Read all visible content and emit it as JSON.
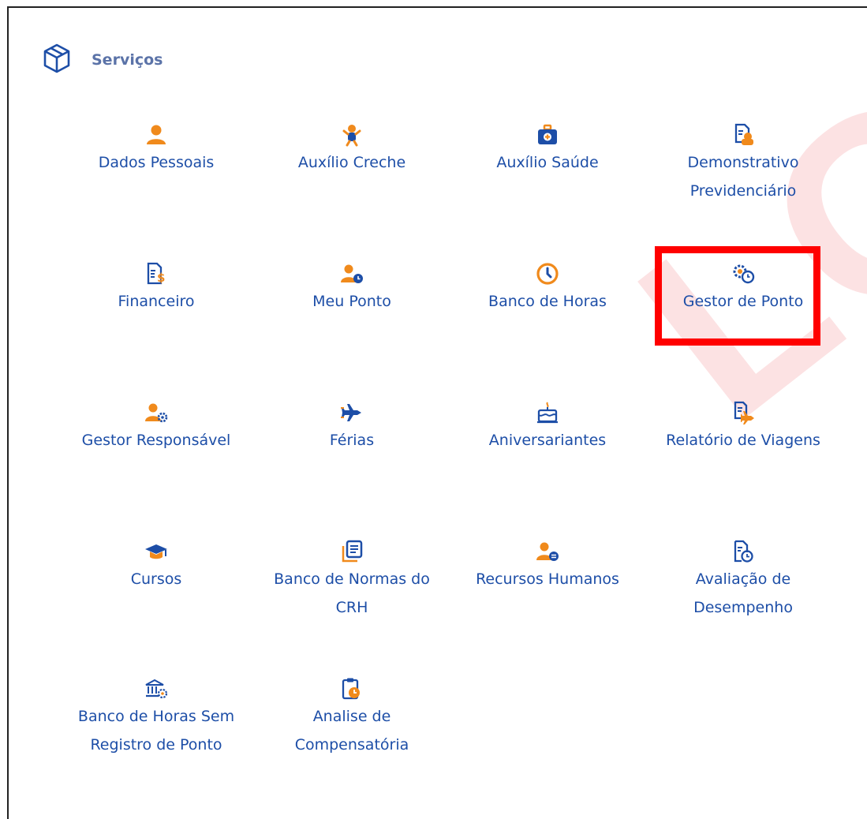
{
  "header": {
    "title": "Serviços",
    "icon": "package-icon"
  },
  "watermark": "LOG",
  "colors": {
    "accent_orange": "#f08a1c",
    "text_blue": "#1d4ea7",
    "icon_blue": "#1d4ea7",
    "header_gray_blue": "#5b73a8",
    "highlight_red": "#ff0000"
  },
  "services": [
    {
      "id": "dados-pessoais",
      "label": "Dados Pessoais",
      "icon": "person-icon"
    },
    {
      "id": "auxilio-creche",
      "label": "Auxílio Creche",
      "icon": "baby-icon"
    },
    {
      "id": "auxilio-saude",
      "label": "Auxílio Saúde",
      "icon": "medical-kit-icon"
    },
    {
      "id": "demonstrativo-previdenciario",
      "label": "Demonstrativo Previdenciário",
      "icon": "document-hands-icon"
    },
    {
      "id": "financeiro",
      "label": "Financeiro",
      "icon": "document-dollar-icon"
    },
    {
      "id": "meu-ponto",
      "label": "Meu Ponto",
      "icon": "person-clock-icon"
    },
    {
      "id": "banco-de-horas",
      "label": "Banco de Horas",
      "icon": "clock-icon"
    },
    {
      "id": "gestor-de-ponto",
      "label": "Gestor de Ponto",
      "icon": "gear-clock-icon"
    },
    {
      "id": "gestor-responsavel",
      "label": "Gestor Responsável",
      "icon": "person-gear-icon"
    },
    {
      "id": "ferias",
      "label": "Férias",
      "icon": "airplane-icon"
    },
    {
      "id": "aniversariantes",
      "label": "Aniversariantes",
      "icon": "cake-icon"
    },
    {
      "id": "relatorio-de-viagens",
      "label": "Relatório de Viagens",
      "icon": "document-airplane-icon"
    },
    {
      "id": "cursos",
      "label": "Cursos",
      "icon": "graduation-cap-icon"
    },
    {
      "id": "banco-de-normas",
      "label": "Banco de Normas do CRH",
      "icon": "documents-stack-icon"
    },
    {
      "id": "recursos-humanos",
      "label": "Recursos Humanos",
      "icon": "person-card-icon"
    },
    {
      "id": "avaliacao-de-desempenho",
      "label": "Avaliação de Desempenho",
      "icon": "document-clock-icon"
    },
    {
      "id": "banco-de-horas-sem-registro",
      "label": "Banco de Horas Sem Registro de Ponto",
      "icon": "bank-gear-icon"
    },
    {
      "id": "analise-de-compensatoria",
      "label": "Analise de Compensatória",
      "icon": "clipboard-clock-icon"
    }
  ]
}
